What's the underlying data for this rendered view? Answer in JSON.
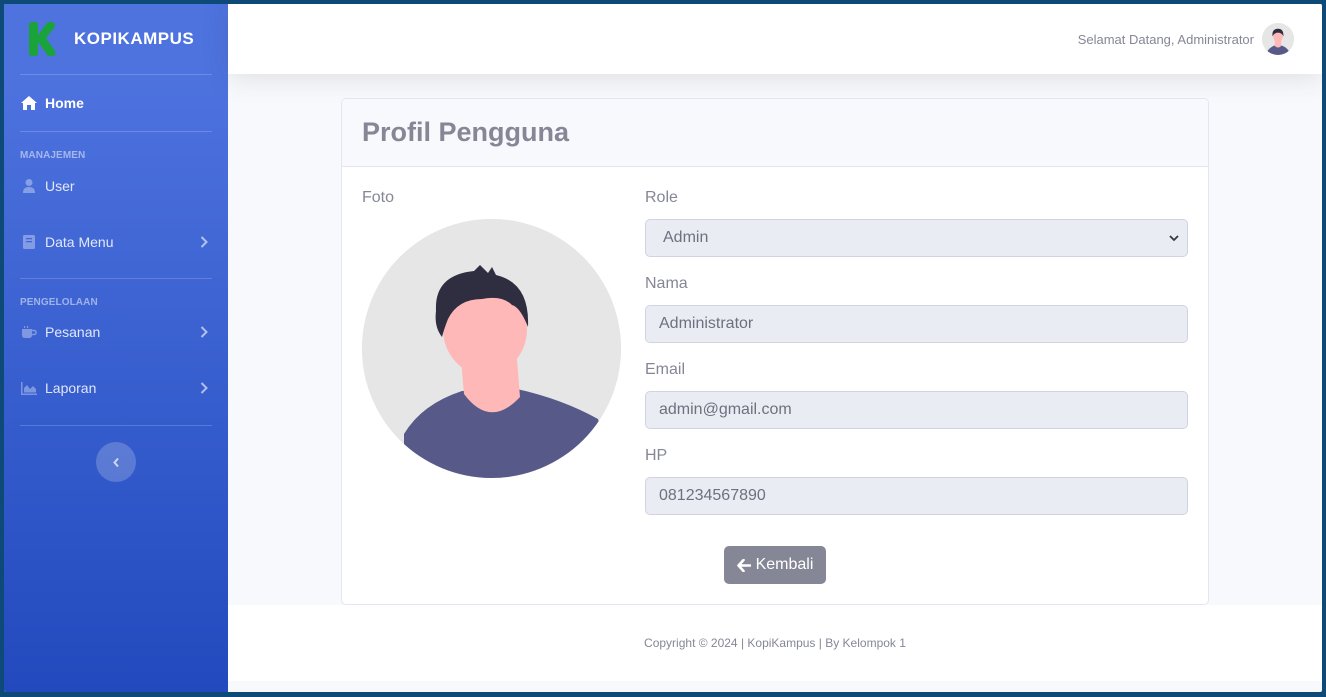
{
  "brand": {
    "name": "KOPIKAMPUS",
    "logo_color": "#1aa33a"
  },
  "sidebar": {
    "home": {
      "label": "Home",
      "icon": "home-icon"
    },
    "heading_manajemen": "MANAJEMEN",
    "user": {
      "label": "User",
      "icon": "user-icon"
    },
    "data_menu": {
      "label": "Data Menu",
      "icon": "book-icon"
    },
    "heading_pengelolaan": "PENGELOLAAN",
    "pesanan": {
      "label": "Pesanan",
      "icon": "coffee-icon"
    },
    "laporan": {
      "label": "Laporan",
      "icon": "chart-area-icon"
    }
  },
  "topbar": {
    "welcome": "Selamat Datang, Administrator"
  },
  "card": {
    "title": "Profil Pengguna",
    "foto_label": "Foto",
    "role_label": "Role",
    "role_value": "Admin",
    "nama_label": "Nama",
    "nama_value": "Administrator",
    "email_label": "Email",
    "email_value": "admin@gmail.com",
    "hp_label": "HP",
    "hp_value": "081234567890",
    "back_button": "Kembali"
  },
  "footer": {
    "text": "Copyright © 2024 | KopiKampus | By Kelompok 1"
  },
  "colors": {
    "primary": "#4e73df",
    "secondary": "#858796"
  }
}
